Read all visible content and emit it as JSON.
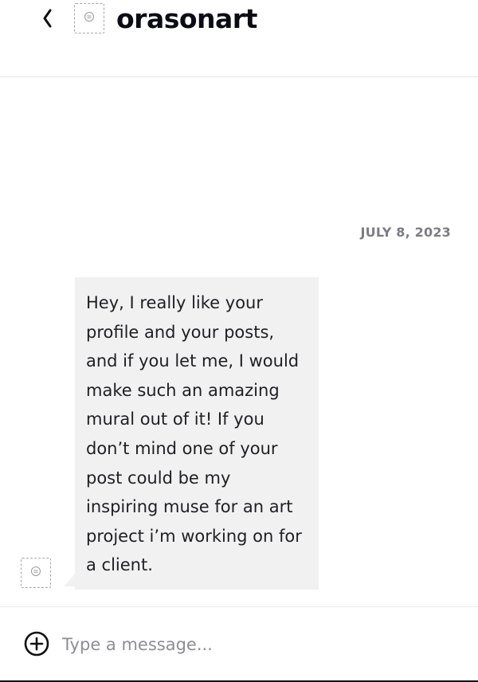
{
  "header": {
    "title": "orasonart",
    "back_icon": "chevron-left-icon",
    "avatar_icon": "avatar-placeholder-icon"
  },
  "conversation": {
    "date_separator": "JULY 8, 2023",
    "messages": [
      {
        "direction": "incoming",
        "avatar_icon": "avatar-placeholder-icon",
        "text": "Hey, I really like your profile and your posts, and if you let me, I would make such an amazing mural out of it! If you don’t mind one of your post could be my inspiring muse for an art project i’m working on for a client."
      }
    ]
  },
  "composer": {
    "add_icon": "plus-circle-icon",
    "placeholder": "Type a message...",
    "value": ""
  },
  "colors": {
    "bubble_bg": "#f1f1f2",
    "title_text": "#0b0b14",
    "muted_text": "#7c7c84"
  }
}
